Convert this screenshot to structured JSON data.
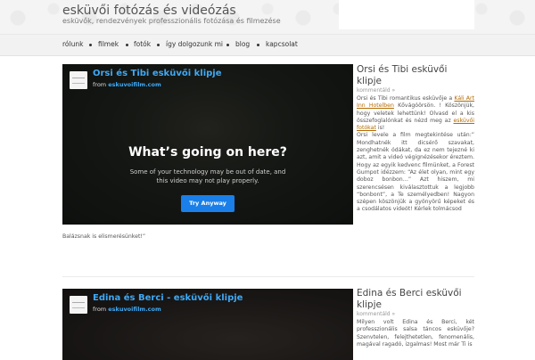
{
  "site": {
    "title": "esküvői fotózás és videózás",
    "tagline": "esküvők, rendezvények professzionális fotózása és filmezése"
  },
  "nav": {
    "items": [
      "rólunk",
      "filmek",
      "fotók",
      "így dolgozunk mi",
      "blog",
      "kapcsolat"
    ]
  },
  "posts": [
    {
      "video": {
        "title": "Orsi és Tibi esküvői klipje",
        "from_label": "from",
        "from_site": "eskuvoifilm.com",
        "warning_heading": "What’s going on here?",
        "warning_text": "Some of your technology may be out of date, and this video may not play properly.",
        "button_label": "Try Anyway"
      },
      "sidebar": {
        "title": "Orsi és Tibi esküvői klipje",
        "meta": "kommentáld »",
        "body_1": "Orsi és Tibi romantikus esküvője a",
        "link_1": "Káli Art Inn Hotelben",
        "body_2": "Kővágóörsön. ! Köszönjük, hogy veletek lehettünk! Olvasd el a kis összefoglalónkat és nézd meg az",
        "link_2": "esküvői fotókat",
        "body_3": "is!",
        "body_4": "Orsi levele a film megtekintése után:” Mondhatnék itt dicsérő szavakat, zenghetnék ódákat, da ez nem tejezné ki azt, amit a videó végignézésekor éreztem. Hogy az egyik kedvenc filmünket, a Forest Gumpot idézzem: “Az élet olyan, mint egy doboz bonbon…” Azt hiszem, mi szerencsésen kiválasztottuk a legjobb “bonbont”, a Te személyedben! Nagyon szépen köszönjük a gyönyörű képeket és a csodálatos videót! Kérlek tolmácsod"
      },
      "tail_text": "Balázsnak is elismerésünket!”"
    },
    {
      "video": {
        "title": "Edina és Berci - esküvői klipje",
        "from_label": "from",
        "from_site": "eskuvoifilm.com"
      },
      "sidebar": {
        "title": "Edina és Berci esküvői klipje",
        "meta": "kommentáld »",
        "body": "Milyen volt Edina és Berci, két professzionális salsa táncos esküvője? Szenvtelen, felejthetetlen, fenomenális, magával ragadó, izgalmas! Most már Ti is"
      }
    }
  ]
}
